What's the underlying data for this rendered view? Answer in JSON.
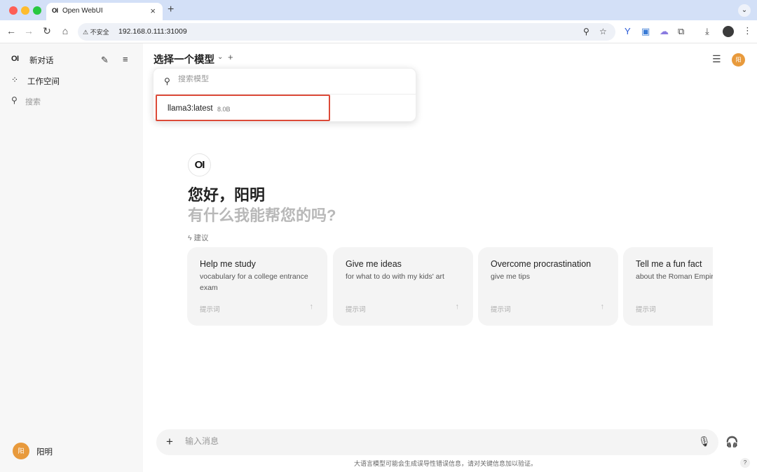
{
  "browser": {
    "tab_logo": "OI",
    "tab_title": "Open WebUI",
    "tab_close": "×",
    "new_tab": "+",
    "insecure_label": "⚠ 不安全",
    "url": "192.168.0.111:31009"
  },
  "sidebar": {
    "logo": "OI",
    "new_chat_label": "新对话",
    "workspace_label": "工作空间",
    "search_label": "搜索",
    "user_avatar": "阳",
    "user_name": "阳明"
  },
  "header": {
    "model_selector_label": "选择一个模型",
    "user_avatar": "阳"
  },
  "model_dropdown": {
    "search_placeholder": "搜索模型",
    "items": [
      {
        "name": "llama3:latest",
        "size": "8.0B"
      }
    ]
  },
  "welcome": {
    "logo": "OI",
    "greeting": "您好，阳明",
    "subtitle": "有什么我能帮您的吗?",
    "suggestions_label": "ϟ 建议"
  },
  "suggestions": [
    {
      "title": "Help me study",
      "description": "vocabulary for a college entrance exam",
      "prompt_label": "提示词"
    },
    {
      "title": "Give me ideas",
      "description": "for what to do with my kids' art",
      "prompt_label": "提示词"
    },
    {
      "title": "Overcome procrastination",
      "description": "give me tips",
      "prompt_label": "提示词"
    },
    {
      "title": "Tell me a fun fact",
      "description": "about the Roman Empire",
      "prompt_label": "提示词"
    }
  ],
  "chat_input": {
    "placeholder": "输入消息",
    "disclaimer": "大语言模型可能会生成误导性错误信息，请对关键信息加以验证。",
    "help": "?"
  },
  "colors": {
    "accent_avatar": "#e89a3c",
    "highlight_box": "#dc4a38"
  }
}
